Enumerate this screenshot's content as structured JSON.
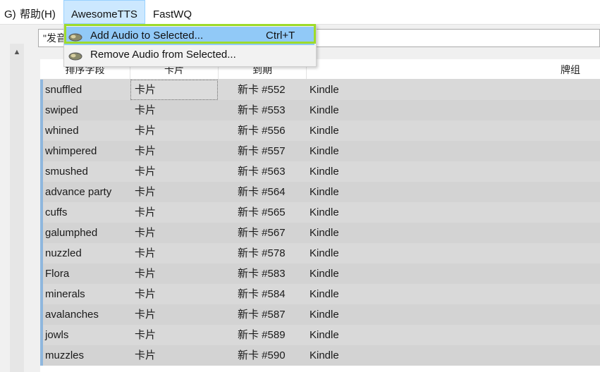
{
  "menubar": {
    "items": [
      {
        "label": "G)"
      },
      {
        "label": "帮助(H)"
      },
      {
        "label": "AwesomeTTS"
      },
      {
        "label": "FastWQ"
      }
    ]
  },
  "search": {
    "value": "\"发音"
  },
  "dropdown": {
    "items": [
      {
        "label": "Add Audio to Selected...",
        "shortcut": "Ctrl+T",
        "icon": "speaker-icon"
      },
      {
        "label": "Remove Audio from Selected...",
        "shortcut": "",
        "icon": "speaker-icon"
      }
    ]
  },
  "table": {
    "columns": [
      "排序字段",
      "卡片",
      "到期",
      "牌组"
    ],
    "rows": [
      {
        "sort_field": "snuffled",
        "card": "卡片",
        "due": "新卡 #552",
        "deck": "Kindle"
      },
      {
        "sort_field": "swiped",
        "card": "卡片",
        "due": "新卡 #553",
        "deck": "Kindle"
      },
      {
        "sort_field": "whined",
        "card": "卡片",
        "due": "新卡 #556",
        "deck": "Kindle"
      },
      {
        "sort_field": "whimpered",
        "card": "卡片",
        "due": "新卡 #557",
        "deck": "Kindle"
      },
      {
        "sort_field": "smushed",
        "card": "卡片",
        "due": "新卡 #563",
        "deck": "Kindle"
      },
      {
        "sort_field": "advance party",
        "card": "卡片",
        "due": "新卡 #564",
        "deck": "Kindle"
      },
      {
        "sort_field": "cuffs",
        "card": "卡片",
        "due": "新卡 #565",
        "deck": "Kindle"
      },
      {
        "sort_field": "galumphed",
        "card": "卡片",
        "due": "新卡 #567",
        "deck": "Kindle"
      },
      {
        "sort_field": "nuzzled",
        "card": "卡片",
        "due": "新卡 #578",
        "deck": "Kindle"
      },
      {
        "sort_field": "Flora",
        "card": "卡片",
        "due": "新卡 #583",
        "deck": "Kindle"
      },
      {
        "sort_field": "minerals",
        "card": "卡片",
        "due": "新卡 #584",
        "deck": "Kindle"
      },
      {
        "sort_field": "avalanches",
        "card": "卡片",
        "due": "新卡 #587",
        "deck": "Kindle"
      },
      {
        "sort_field": "jowls",
        "card": "卡片",
        "due": "新卡 #589",
        "deck": "Kindle"
      },
      {
        "sort_field": "muzzles",
        "card": "卡片",
        "due": "新卡 #590",
        "deck": "Kindle"
      }
    ]
  },
  "colors": {
    "row_bg": "#d9d9d9",
    "menu_highlight": "#91c9f7",
    "frame_highlight": "#9edb2a"
  }
}
